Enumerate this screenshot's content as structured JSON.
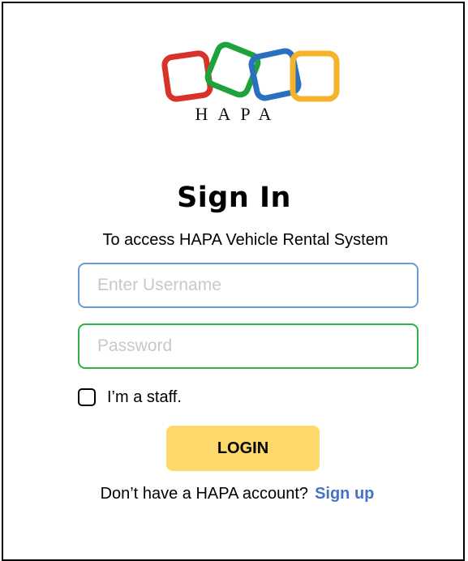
{
  "brand": {
    "logo_icon": "hapa-interlocked-squares-logo",
    "name": "HAPA",
    "colors": {
      "red": "#d9322b",
      "green": "#1fa23c",
      "blue": "#2b6fc1",
      "yellow": "#f4b32b"
    }
  },
  "signin": {
    "title": "Sign In",
    "subtitle": "To access HAPA Vehicle Rental System"
  },
  "form": {
    "username_placeholder": "Enter Username",
    "username_value": "",
    "password_placeholder": "Password",
    "password_value": "",
    "staff_label": "I’m a staff.",
    "staff_checked": false,
    "login_label": "LOGIN",
    "login_color": "#fcd96a"
  },
  "signup": {
    "prompt": "Don’t have a HAPA account?",
    "link_label": "Sign up",
    "link_color": "#4472c4"
  }
}
